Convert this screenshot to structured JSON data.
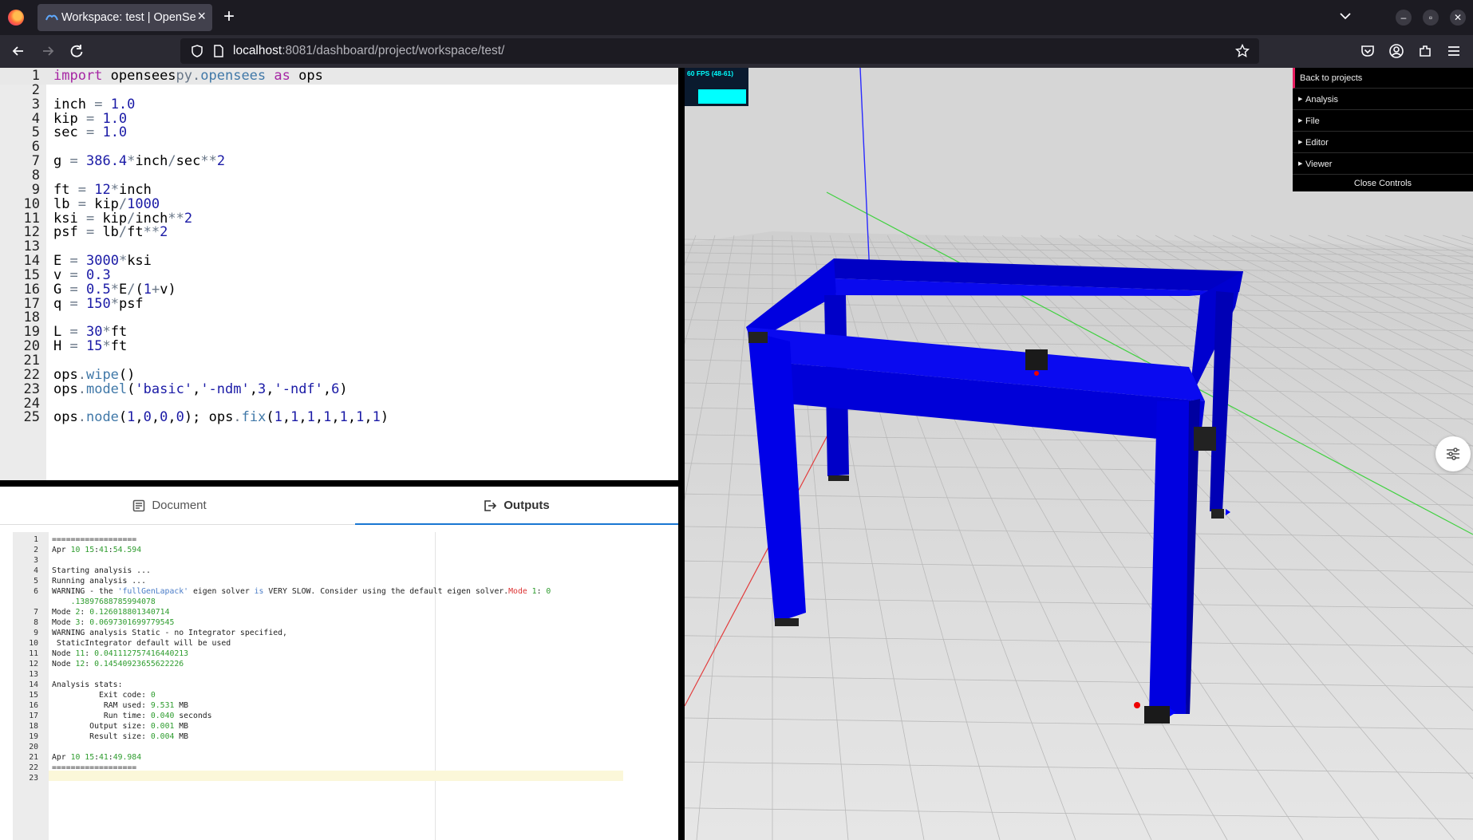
{
  "browser": {
    "tab_title": "Workspace: test | OpenSees",
    "url_host": "localhost",
    "url_rest": ":8081/dashboard/project/workspace/test/"
  },
  "editor": {
    "lines": [
      {
        "n": "1",
        "html": "<span class=\"kw\">import</span> opensees<span class=\"op\">py.</span><span class=\"fn\">opensees</span> <span class=\"kw\">as</span> ops"
      },
      {
        "n": "2",
        "html": ""
      },
      {
        "n": "3",
        "html": "inch <span class=\"op\">=</span> <span class=\"num\">1.0</span>"
      },
      {
        "n": "4",
        "html": "kip <span class=\"op\">=</span> <span class=\"num\">1.0</span>"
      },
      {
        "n": "5",
        "html": "sec <span class=\"op\">=</span> <span class=\"num\">1.0</span>"
      },
      {
        "n": "6",
        "html": ""
      },
      {
        "n": "7",
        "html": "g <span class=\"op\">=</span> <span class=\"num\">386.4</span><span class=\"op\">*</span>inch<span class=\"op\">/</span>sec<span class=\"op\">**</span><span class=\"num\">2</span>"
      },
      {
        "n": "8",
        "html": ""
      },
      {
        "n": "9",
        "html": "ft <span class=\"op\">=</span> <span class=\"num\">12</span><span class=\"op\">*</span>inch"
      },
      {
        "n": "10",
        "html": "lb <span class=\"op\">=</span> kip<span class=\"op\">/</span><span class=\"num\">1000</span>"
      },
      {
        "n": "11",
        "html": "ksi <span class=\"op\">=</span> kip<span class=\"op\">/</span>inch<span class=\"op\">**</span><span class=\"num\">2</span>"
      },
      {
        "n": "12",
        "html": "psf <span class=\"op\">=</span> lb<span class=\"op\">/</span>ft<span class=\"op\">**</span><span class=\"num\">2</span>"
      },
      {
        "n": "13",
        "html": ""
      },
      {
        "n": "14",
        "html": "E <span class=\"op\">=</span> <span class=\"num\">3000</span><span class=\"op\">*</span>ksi"
      },
      {
        "n": "15",
        "html": "v <span class=\"op\">=</span> <span class=\"num\">0.3</span>"
      },
      {
        "n": "16",
        "html": "G <span class=\"op\">=</span> <span class=\"num\">0.5</span><span class=\"op\">*</span>E<span class=\"op\">/</span>(<span class=\"num\">1</span><span class=\"op\">+</span>v)"
      },
      {
        "n": "17",
        "html": "q <span class=\"op\">=</span> <span class=\"num\">150</span><span class=\"op\">*</span>psf"
      },
      {
        "n": "18",
        "html": ""
      },
      {
        "n": "19",
        "html": "L <span class=\"op\">=</span> <span class=\"num\">30</span><span class=\"op\">*</span>ft"
      },
      {
        "n": "20",
        "html": "H <span class=\"op\">=</span> <span class=\"num\">15</span><span class=\"op\">*</span>ft"
      },
      {
        "n": "21",
        "html": ""
      },
      {
        "n": "22",
        "html": "ops<span class=\"op\">.</span><span class=\"fn\">wipe</span>()"
      },
      {
        "n": "23",
        "html": "ops<span class=\"op\">.</span><span class=\"fn\">model</span>(<span class=\"str\">'basic'</span>,<span class=\"str\">'-ndm'</span>,<span class=\"num\">3</span>,<span class=\"str\">'-ndf'</span>,<span class=\"num\">6</span>)"
      },
      {
        "n": "24",
        "html": ""
      },
      {
        "n": "25",
        "html": "ops<span class=\"op\">.</span><span class=\"fn\">node</span>(<span class=\"num\">1</span>,<span class=\"num\">0</span>,<span class=\"num\">0</span>,<span class=\"num\">0</span>); ops<span class=\"op\">.</span><span class=\"fn\">fix</span>(<span class=\"num\">1</span>,<span class=\"num\">1</span>,<span class=\"num\">1</span>,<span class=\"num\">1</span>,<span class=\"num\">1</span>,<span class=\"num\">1</span>,<span class=\"num\">1</span>)"
      }
    ]
  },
  "bottom": {
    "tab_document": "Document",
    "tab_outputs": "Outputs"
  },
  "outputs": {
    "lines": [
      {
        "n": "1",
        "html": "=================="
      },
      {
        "n": "2",
        "html": "Apr <span class=\"g\">10</span> <span class=\"g\">15</span>:<span class=\"g\">41</span>:<span class=\"g\">54.594</span>"
      },
      {
        "n": "3",
        "html": ""
      },
      {
        "n": "4",
        "html": "Starting analysis ..."
      },
      {
        "n": "5",
        "html": "Running analysis ..."
      },
      {
        "n": "6",
        "html": "WARNING - the <span class=\"b\">'fullGenLapack'</span> eigen solver <span class=\"b\">is</span> VERY SLOW. Consider using the default eigen solver.<span class=\"r\">Mode</span> <span class=\"g\">1</span>: <span class=\"g\">0</span>"
      },
      {
        "n": "",
        "html": "    <span class=\"g\">.13897688785994078</span>"
      },
      {
        "n": "7",
        "html": "Mode <span class=\"g\">2</span>: <span class=\"g\">0.126018801340714</span>"
      },
      {
        "n": "8",
        "html": "Mode <span class=\"g\">3</span>: <span class=\"g\">0.0697301699779545</span>"
      },
      {
        "n": "9",
        "html": "WARNING analysis Static - no Integrator specified,"
      },
      {
        "n": "10",
        "html": " StaticIntegrator default will be used"
      },
      {
        "n": "11",
        "html": "Node <span class=\"g\">11</span>: <span class=\"g\">0.041112757416440213</span>"
      },
      {
        "n": "12",
        "html": "Node <span class=\"g\">12</span>: <span class=\"g\">0.14540923655622226</span>"
      },
      {
        "n": "13",
        "html": ""
      },
      {
        "n": "14",
        "html": "Analysis stats:"
      },
      {
        "n": "15",
        "html": "          Exit code: <span class=\"g\">0</span>"
      },
      {
        "n": "16",
        "html": "           RAM used: <span class=\"g\">9.531</span> MB"
      },
      {
        "n": "17",
        "html": "           Run time: <span class=\"g\">0.040</span> seconds"
      },
      {
        "n": "18",
        "html": "        Output size: <span class=\"g\">0.001</span> MB"
      },
      {
        "n": "19",
        "html": "        Result size: <span class=\"g\">0.004</span> MB"
      },
      {
        "n": "20",
        "html": ""
      },
      {
        "n": "21",
        "html": "Apr <span class=\"g\">10</span> <span class=\"g\">15</span>:<span class=\"g\">41</span>:<span class=\"g\">49.984</span>"
      },
      {
        "n": "22",
        "html": "=================="
      },
      {
        "n": "23",
        "html": ""
      }
    ]
  },
  "viewer": {
    "fps": "60 FPS (48-61)",
    "controls": {
      "back": "Back to projects",
      "analysis": "Analysis",
      "file": "File",
      "editor": "Editor",
      "viewer": "Viewer",
      "close": "Close Controls"
    }
  },
  "colors": {
    "frame": "#0000ff",
    "accent": "#1976d2",
    "fps": "#00ffff"
  },
  "icons": [
    "firefox-icon",
    "opensees-icon",
    "back-arrow-icon",
    "forward-arrow-icon",
    "reload-icon",
    "shield-icon",
    "page-icon",
    "star-icon",
    "pocket-icon",
    "account-icon",
    "extensions-icon",
    "menu-icon",
    "tab-list-icon",
    "document-icon",
    "outputs-icon",
    "sliders-icon"
  ]
}
